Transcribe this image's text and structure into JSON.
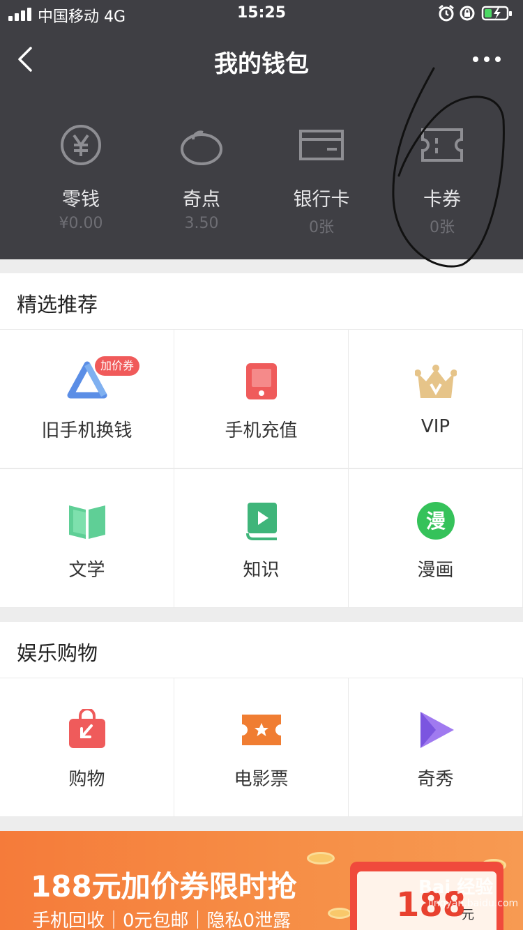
{
  "status_bar": {
    "carrier": "中国移动 4G",
    "time": "15:25"
  },
  "nav": {
    "title": "我的钱包"
  },
  "wallet": [
    {
      "label": "零钱",
      "value": "¥0.00",
      "icon": "yuan-coin-icon"
    },
    {
      "label": "奇点",
      "value": "3.50",
      "icon": "bean-icon"
    },
    {
      "label": "银行卡",
      "value": "0张",
      "icon": "bank-card-icon"
    },
    {
      "label": "卡券",
      "value": "0张",
      "icon": "coupon-icon"
    }
  ],
  "featured": {
    "title": "精选推荐",
    "items": [
      {
        "label": "旧手机换钱",
        "icon": "recycle-triangle-icon",
        "badge": "加价券"
      },
      {
        "label": "手机充值",
        "icon": "phone-recharge-icon"
      },
      {
        "label": "VIP",
        "icon": "crown-icon"
      },
      {
        "label": "文学",
        "icon": "open-book-icon"
      },
      {
        "label": "知识",
        "icon": "knowledge-book-icon"
      },
      {
        "label": "漫画",
        "icon": "comic-icon",
        "glyph": "漫"
      }
    ]
  },
  "entertainment": {
    "title": "娱乐购物",
    "items": [
      {
        "label": "购物",
        "icon": "shopping-bag-icon"
      },
      {
        "label": "电影票",
        "icon": "movie-ticket-icon"
      },
      {
        "label": "奇秀",
        "icon": "play-show-icon"
      }
    ]
  },
  "banner": {
    "title": "188元加价券限时抢",
    "subtitle": "手机回收｜0元包邮｜隐私0泄露",
    "amount": "188",
    "unit": "元"
  },
  "watermark": {
    "text": "Bai 经验",
    "sub": "jingyan.baidu.com"
  },
  "colors": {
    "header_bg": "#3f3f44",
    "banner_orange": "#f68e46",
    "badge_red": "#f05a5a"
  }
}
